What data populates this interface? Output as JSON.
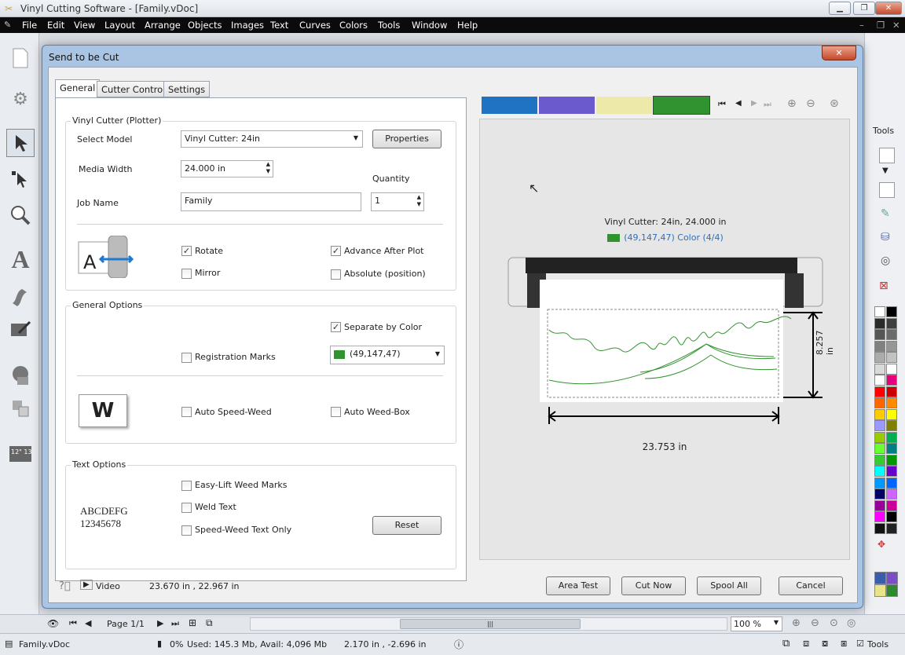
{
  "app": {
    "title": "Vinyl Cutting Software - [Family.vDoc]",
    "menu": [
      "File",
      "Edit",
      "View",
      "Layout",
      "Arrange",
      "Objects",
      "Images",
      "Text",
      "Curves",
      "Colors",
      "Tools",
      "Window",
      "Help"
    ]
  },
  "right_panel": {
    "tools_label": "Tools",
    "palette": [
      "#ffffff",
      "#000000",
      "#2b2b2b",
      "#3f3f3f",
      "#555555",
      "#6b6b6b",
      "#808080",
      "#969696",
      "#ababab",
      "#c2c2c2",
      "#d9d9d9",
      "#ffffff",
      "#ffffff",
      "#e6007e",
      "#ff0000",
      "#cc0000",
      "#ff6600",
      "#ff8c00",
      "#ffcc00",
      "#ffff00",
      "#9999ff",
      "#808000",
      "#99cc00",
      "#00b050",
      "#66ff33",
      "#008080",
      "#33cc33",
      "#009900",
      "#00ffff",
      "#6600cc",
      "#0099ff",
      "#0066ff",
      "#000066",
      "#cc66ff",
      "#990099",
      "#cc0099",
      "#ff00ff",
      "#000000",
      "#111111",
      "#222222"
    ],
    "bottom_swatches": [
      "#3b5ea8",
      "#7b4dc7",
      "#e8e48a",
      "#2d8a2d"
    ]
  },
  "dialog": {
    "title": "Send to be Cut",
    "tabs": [
      "General",
      "Cutter Control",
      "Settings"
    ],
    "cutter": {
      "group_title": "Vinyl Cutter (Plotter)",
      "model_label": "Select Model",
      "model_value": "Vinyl Cutter: 24in",
      "properties": "Properties",
      "media_label": "Media Width",
      "media_value": "24.000 in",
      "quantity_label": "Quantity",
      "quantity_value": "1",
      "job_label": "Job Name",
      "job_value": "Family",
      "rotate": "Rotate",
      "mirror": "Mirror",
      "advance": "Advance After Plot",
      "absolute": "Absolute (position)"
    },
    "general": {
      "group_title": "General Options",
      "separate": "Separate by Color",
      "registration": "Registration Marks",
      "color_value": "(49,147,47)",
      "weed_icon": "W",
      "auto_speed_weed": "Auto Speed-Weed",
      "auto_weed_box": "Auto Weed-Box"
    },
    "text": {
      "group_title": "Text Options",
      "sample_line1": "ABCDEFG",
      "sample_line2": "12345678",
      "easy_lift": "Easy-Lift Weed Marks",
      "weld": "Weld Text",
      "speed_weed_text": "Speed-Weed Text Only",
      "reset": "Reset"
    },
    "preview": {
      "colors": [
        "#1f73c2",
        "#6a5acd",
        "#ede9a8",
        "#31932f"
      ],
      "cutter_info": "Vinyl Cutter: 24in,  24.000 in",
      "color_info": "(49,147,47) Color (4/4)",
      "height": "8.257 in",
      "width": "23.753 in"
    },
    "footer": {
      "video": "Video",
      "coords": "23.670 in , 22.967 in",
      "area_test": "Area Test",
      "cut_now": "Cut Now",
      "spool_all": "Spool All",
      "cancel": "Cancel"
    }
  },
  "nav": {
    "page": "Page 1/1",
    "zoom": "100 %"
  },
  "status": {
    "file": "Family.vDoc",
    "progress": "0%",
    "memory": "Used: 145.3 Mb, Avail: 4,096 Mb",
    "cursor": "2.170 in , -2.696 in",
    "tools": "Tools"
  }
}
